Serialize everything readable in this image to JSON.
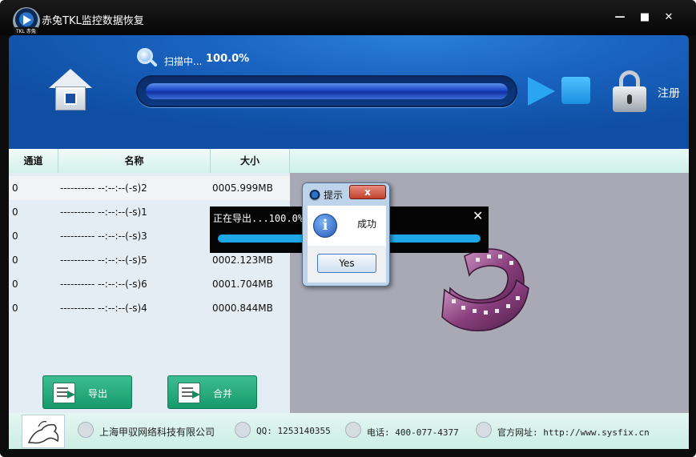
{
  "window": {
    "title": "赤兔TKL监控数据恢复",
    "logo_tag": "TKL 赤兔",
    "controls": {
      "minimize": "—",
      "maximize": "■",
      "close": "✕"
    }
  },
  "header": {
    "scan_label": "扫描中...",
    "scan_percent": "100.0%",
    "progress": 1.0,
    "register_label": "注册"
  },
  "table": {
    "columns": [
      "通道",
      "名称",
      "大小"
    ],
    "rows": [
      {
        "channel": "0",
        "name": "---------- --:--:--(-s)2",
        "size": "0005.999MB"
      },
      {
        "channel": "0",
        "name": "---------- --:--:--(-s)1",
        "size": ""
      },
      {
        "channel": "0",
        "name": "---------- --:--:--(-s)3",
        "size": ""
      },
      {
        "channel": "0",
        "name": "---------- --:--:--(-s)5",
        "size": "0002.123MB"
      },
      {
        "channel": "0",
        "name": "---------- --:--:--(-s)6",
        "size": "0001.704MB"
      },
      {
        "channel": "0",
        "name": "---------- --:--:--(-s)4",
        "size": "0000.844MB"
      }
    ]
  },
  "actions": {
    "export_label": "导出",
    "merge_label": "合并"
  },
  "export_overlay": {
    "label": "正在导出...100.0%",
    "close": "✕",
    "progress": 1.0
  },
  "dialog": {
    "title": "提示",
    "close": "x",
    "info_glyph": "i",
    "message": "成功",
    "yes_label": "Yes"
  },
  "footer": {
    "company": "上海甲驭网络科技有限公司",
    "qq": "QQ: 1253140355",
    "phone": "电话: 400-077-4377",
    "website": "官方网址: http://www.sysfix.cn"
  }
}
